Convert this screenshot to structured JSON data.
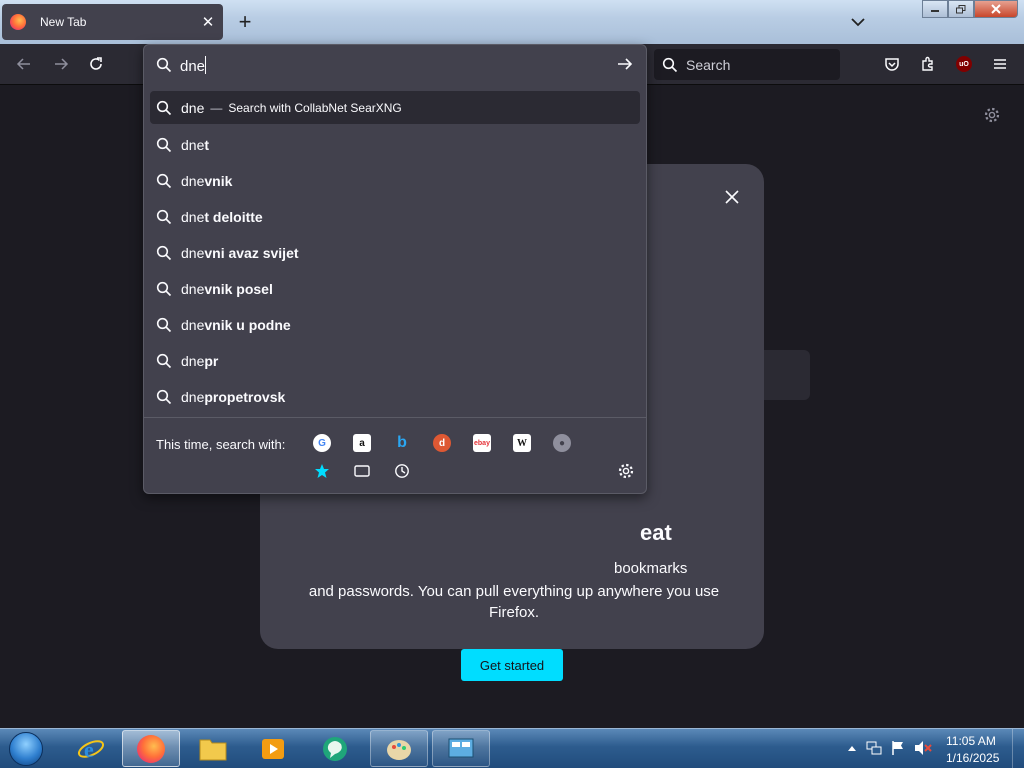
{
  "tab": {
    "title": "New Tab",
    "close_glyph": "✕",
    "new_tab_glyph": "+"
  },
  "navbar": {
    "search_placeholder": "Search"
  },
  "urlbar": {
    "typed": "dne",
    "results": [
      {
        "prefix": "dne",
        "suffix": "",
        "action": "Search with CollabNet SearXNG",
        "selected": true
      },
      {
        "prefix": "dne",
        "suffix": "t"
      },
      {
        "prefix": "dne",
        "suffix": "vnik"
      },
      {
        "prefix": "dne",
        "suffix": "t deloitte"
      },
      {
        "prefix": "dne",
        "suffix": "vni avaz svijet"
      },
      {
        "prefix": "dne",
        "suffix": "vnik posel"
      },
      {
        "prefix": "dne",
        "suffix": "vnik u podne"
      },
      {
        "prefix": "dne",
        "suffix": "pr"
      },
      {
        "prefix": "dne",
        "suffix": "propetrovsk"
      }
    ],
    "separator": "—",
    "oneoff_label": "This time, search with:",
    "engines": [
      "google-icon",
      "amazon-icon",
      "bing-icon",
      "duckduckgo-icon",
      "ebay-icon",
      "wikipedia-icon",
      "searxng-icon",
      "bookmarks-icon",
      "tabs-icon",
      "history-icon"
    ]
  },
  "card": {
    "heading_visible": "eat",
    "body_partial": "bookmarks",
    "body": "and passwords. You can pull everything up anywhere you use Firefox.",
    "cta": "Get started"
  },
  "ublock_badge": "uO",
  "taskbar": {
    "time": "11:05 AM",
    "date": "1/16/2025"
  },
  "colors": {
    "accent": "#00ddff",
    "panel": "#42414d",
    "page": "#1c1b22",
    "toolbar": "#2b2a33"
  }
}
